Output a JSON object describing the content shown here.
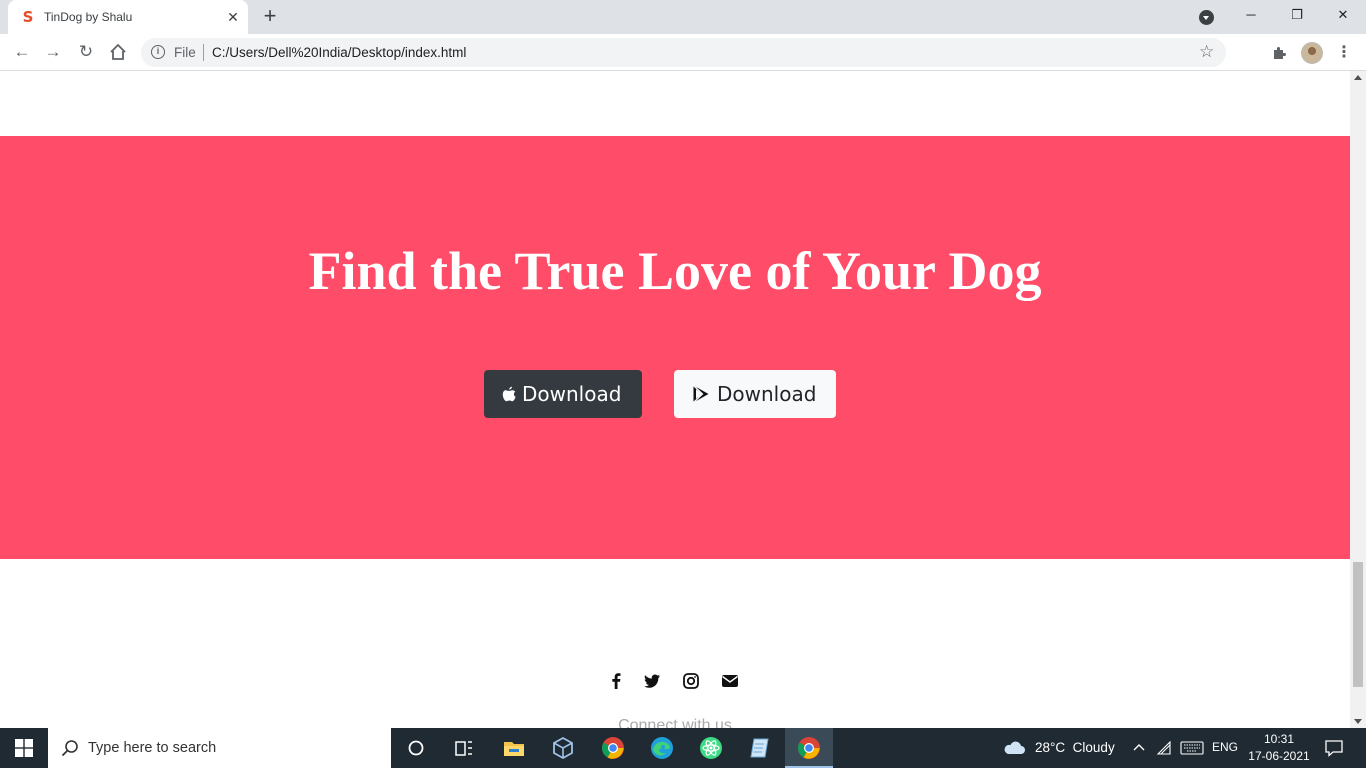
{
  "browser": {
    "tab_title": "TinDog by Shalu",
    "omnibox_scheme": "File",
    "url": "C:/Users/Dell%20India/Desktop/index.html"
  },
  "page": {
    "cta_title": "Find the True Love of Your Dog",
    "apple_download_label": "Download",
    "play_download_label": "Download",
    "connect_text": "Connect with us",
    "accent_color": "#ff4c68"
  },
  "taskbar": {
    "search_placeholder": "Type here to search",
    "weather": "28°C  Cloudy",
    "language": "ENG",
    "time": "10:31",
    "date": "17-06-2021"
  }
}
